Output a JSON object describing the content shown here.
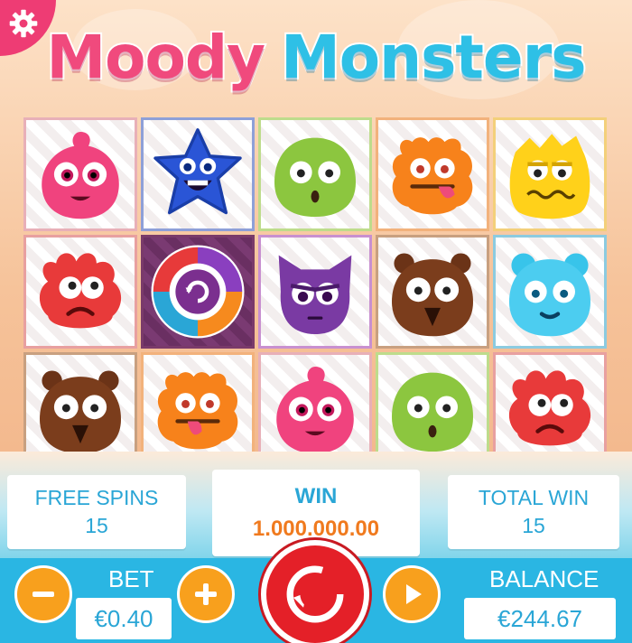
{
  "title": {
    "word1": "Moody",
    "word2": "Monsters"
  },
  "icons": {
    "settings": "gear-icon",
    "minus": "minus-icon",
    "plus": "plus-icon",
    "spin": "spin-icon",
    "autoplay": "play-icon"
  },
  "colors": {
    "accent_pink": "#ee3c74",
    "accent_blue": "#2ab6e3",
    "button_orange": "#f8a01d",
    "spin_red": "#e42028",
    "win_orange": "#f07a1e"
  },
  "reels": [
    [
      "pink-blob-monster",
      "red-horned-monster",
      "brown-eared-monster"
    ],
    [
      "blue-star-monster",
      "bonus-wheel",
      "orange-crab-monster"
    ],
    [
      "green-blob-monster",
      "purple-cat-monster",
      "pink-blob-monster"
    ],
    [
      "orange-crab-monster",
      "brown-eared-monster",
      "green-blob-monster"
    ],
    [
      "yellow-crown-monster",
      "cyan-bear-monster",
      "red-horned-monster"
    ]
  ],
  "panels": {
    "free_spins": {
      "label": "FREE SPINS",
      "value": "15"
    },
    "win": {
      "label": "WIN",
      "value": "1.000.000.00"
    },
    "total_win": {
      "label": "TOTAL WIN",
      "value": "15"
    },
    "bet": {
      "label": "BET",
      "value": "€0.40"
    },
    "balance": {
      "label": "BALANCE",
      "value": "€244.67"
    }
  }
}
